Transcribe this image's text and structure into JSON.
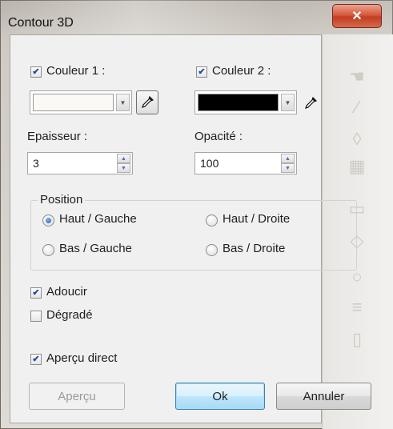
{
  "window": {
    "title": "Contour 3D",
    "close_glyph": "✕"
  },
  "colors": {
    "color1_swatch": "#fbf9f6",
    "color2_swatch": "#000000",
    "accent": "#1f5fb5",
    "close_red": "#c94b2e"
  },
  "color1": {
    "label": "Couleur 1 :",
    "checked": true,
    "picker_icon": "eyedropper-icon"
  },
  "color2": {
    "label": "Couleur 2 :",
    "checked": true,
    "picker_icon": "eyedropper-icon"
  },
  "thickness": {
    "label": "Epaisseur :",
    "value": "3"
  },
  "opacity": {
    "label": "Opacité :",
    "value": "100"
  },
  "position": {
    "title": "Position",
    "options": [
      {
        "label": "Haut / Gauche",
        "selected": true
      },
      {
        "label": "Haut / Droite",
        "selected": false
      },
      {
        "label": "Bas / Gauche",
        "selected": false
      },
      {
        "label": "Bas / Droite",
        "selected": false
      }
    ]
  },
  "options": {
    "smooth": {
      "label": "Adoucir",
      "checked": true
    },
    "gradient": {
      "label": "Dégradé",
      "checked": false
    },
    "live_preview": {
      "label": "Aperçu direct",
      "checked": true
    }
  },
  "buttons": {
    "preview": "Aperçu",
    "ok": "Ok",
    "cancel": "Annuler"
  }
}
